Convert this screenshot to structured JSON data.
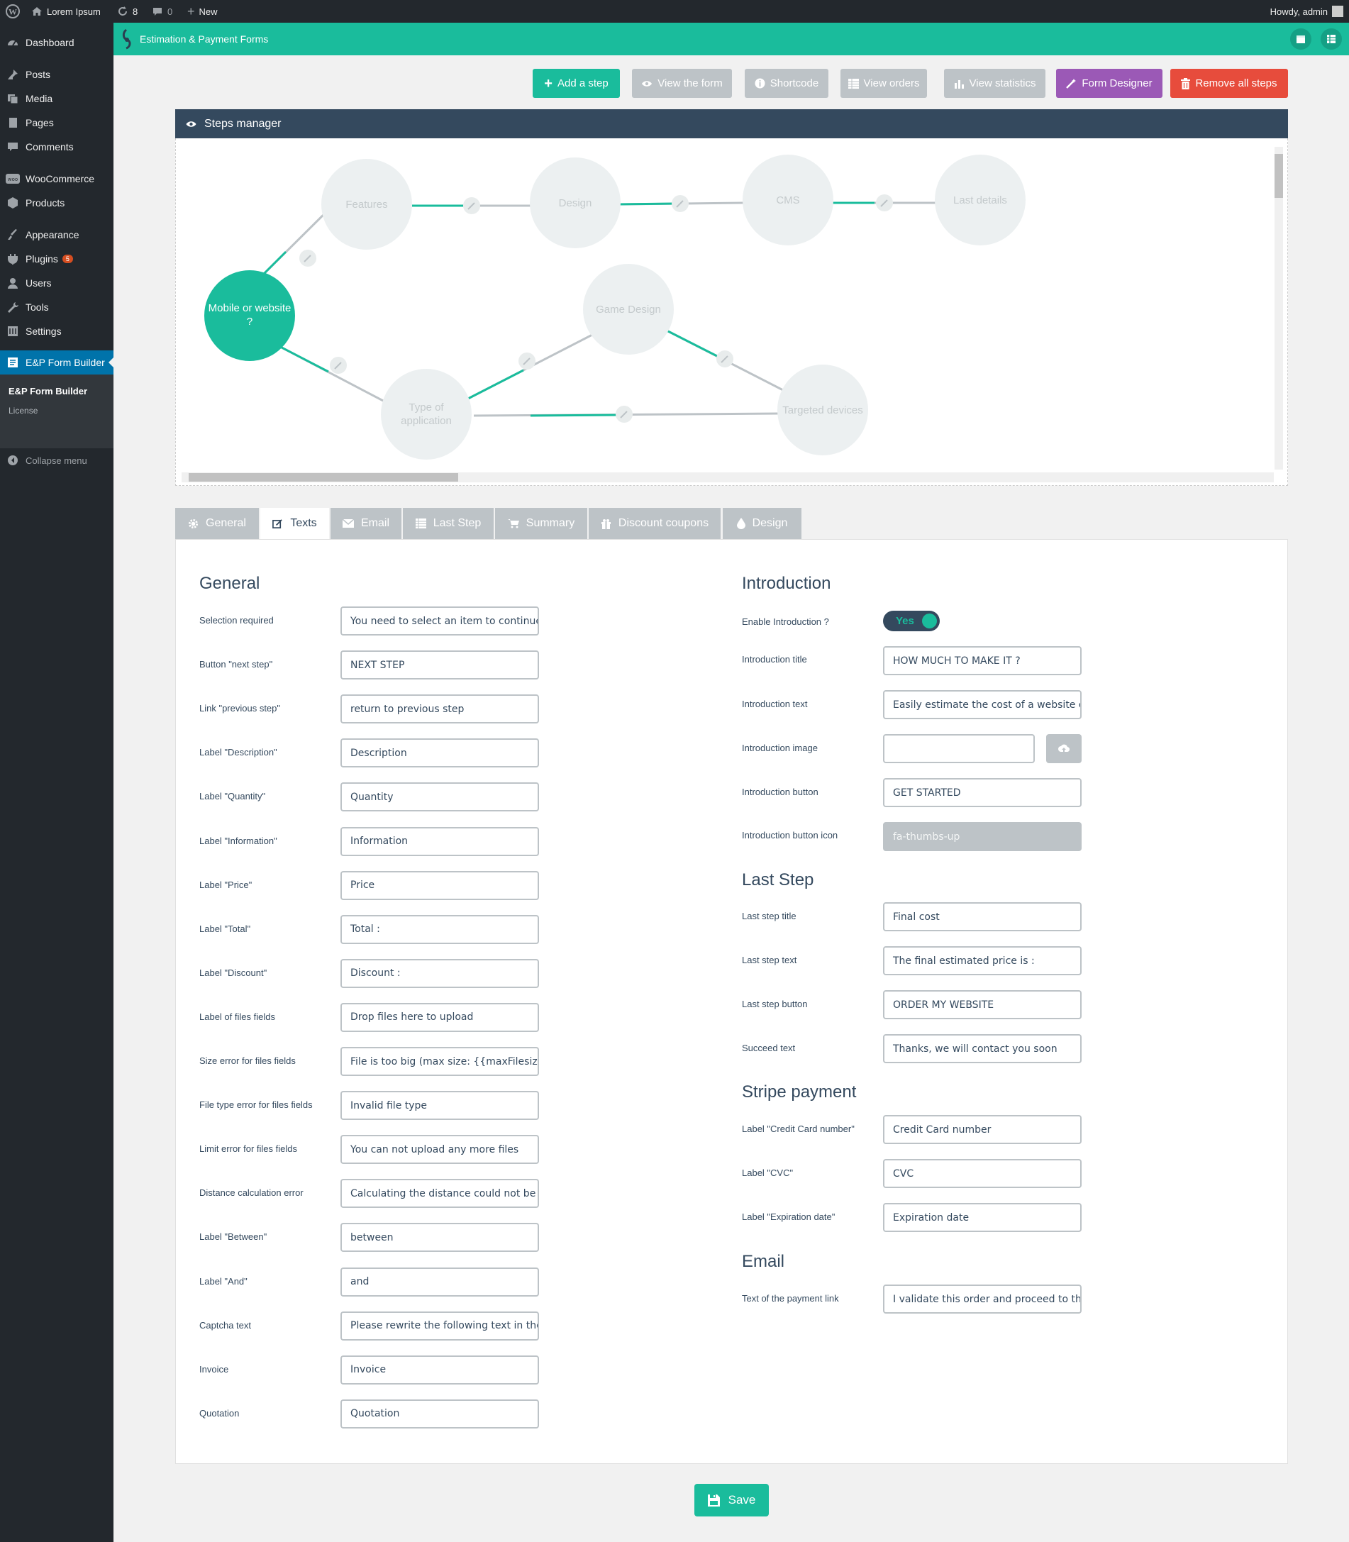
{
  "adminbar": {
    "site_name": "Lorem Ipsum",
    "updates_count": "8",
    "comments_count": "0",
    "new_label": "New",
    "howdy": "Howdy, admin"
  },
  "sidebar": {
    "items": [
      {
        "label": "Dashboard",
        "icon": "dashboard-icon"
      },
      {
        "label": "Posts",
        "icon": "pin-icon"
      },
      {
        "label": "Media",
        "icon": "media-icon"
      },
      {
        "label": "Pages",
        "icon": "page-icon"
      },
      {
        "label": "Comments",
        "icon": "comment-icon"
      },
      {
        "label": "WooCommerce",
        "icon": "woo-icon"
      },
      {
        "label": "Products",
        "icon": "box-icon"
      },
      {
        "label": "Appearance",
        "icon": "brush-icon"
      },
      {
        "label": "Plugins",
        "icon": "plug-icon",
        "badge": "5"
      },
      {
        "label": "Users",
        "icon": "user-icon"
      },
      {
        "label": "Tools",
        "icon": "wrench-icon"
      },
      {
        "label": "Settings",
        "icon": "settings-icon"
      },
      {
        "label": "E&P Form Builder",
        "icon": "form-icon"
      }
    ],
    "submenu": {
      "builder": "E&P Form Builder",
      "license": "License"
    },
    "collapse": "Collapse menu"
  },
  "plugin_header": {
    "title": "Estimation & Payment Forms"
  },
  "toolbar": {
    "add_step": "Add a step",
    "view_form": "View the form",
    "shortcode": "Shortcode",
    "view_orders": "View orders",
    "view_statistics": "View statistics",
    "form_designer": "Form Designer",
    "remove_all_steps": "Remove all steps"
  },
  "steps_manager": {
    "title": "Steps manager",
    "steps": {
      "mobile_line1": "Mobile or website",
      "mobile_line2": "?",
      "features": "Features",
      "design": "Design",
      "cms": "CMS",
      "last_details": "Last details",
      "game_design": "Game Design",
      "type_line1": "Type of",
      "type_line2": "application",
      "targeted_devices": "Targeted devices"
    }
  },
  "tabs": [
    "General",
    "Texts",
    "Email",
    "Last Step",
    "Summary",
    "Discount coupons",
    "Design"
  ],
  "general": {
    "title": "General",
    "fields": [
      {
        "label": "Selection required",
        "value": "You need to select an item to continue"
      },
      {
        "label": "Button \"next step\"",
        "value": "NEXT STEP"
      },
      {
        "label": "Link \"previous step\"",
        "value": "return to previous step"
      },
      {
        "label": "Label \"Description\"",
        "value": "Description"
      },
      {
        "label": "Label \"Quantity\"",
        "value": "Quantity"
      },
      {
        "label": "Label \"Information\"",
        "value": "Information"
      },
      {
        "label": "Label \"Price\"",
        "value": "Price"
      },
      {
        "label": "Label \"Total\"",
        "value": "Total :"
      },
      {
        "label": "Label \"Discount\"",
        "value": "Discount :"
      },
      {
        "label": "Label of files fields",
        "value": "Drop files here to upload"
      },
      {
        "label": "Size error for files fields",
        "value": "File is too big (max size: {{maxFilesize}}MB)"
      },
      {
        "label": "File type error for files fields",
        "value": "Invalid file type"
      },
      {
        "label": "Limit error for files fields",
        "value": "You can not upload any more files"
      },
      {
        "label": "Distance calculation error",
        "value": "Calculating the distance could not be performed"
      },
      {
        "label": "Label \"Between\"",
        "value": "between"
      },
      {
        "label": "Label \"And\"",
        "value": "and"
      },
      {
        "label": "Captcha text",
        "value": "Please rewrite the following text in the field"
      },
      {
        "label": "Invoice",
        "value": "Invoice"
      },
      {
        "label": "Quotation",
        "value": "Quotation"
      }
    ]
  },
  "introduction": {
    "title": "Introduction",
    "enable_label": "Enable Introduction ?",
    "enable_value": "Yes",
    "title_label": "Introduction title",
    "title_value": "HOW MUCH TO MAKE IT ?",
    "text_label": "Introduction text",
    "text_value": "Easily estimate the cost of a website or an app",
    "image_label": "Introduction image",
    "image_value": "",
    "button_label": "Introduction button",
    "button_value": "GET STARTED",
    "icon_label": "Introduction button icon",
    "icon_value": "fa-thumbs-up"
  },
  "last_step": {
    "title": "Last Step",
    "fields": [
      {
        "label": "Last step title",
        "value": "Final cost"
      },
      {
        "label": "Last step text",
        "value": "The final estimated price is :"
      },
      {
        "label": "Last step button",
        "value": "ORDER MY WEBSITE"
      },
      {
        "label": "Succeed text",
        "value": "Thanks, we will contact you soon"
      }
    ]
  },
  "stripe": {
    "title": "Stripe payment",
    "fields": [
      {
        "label": "Label \"Credit Card number\"",
        "value": "Credit Card number"
      },
      {
        "label": "Label \"CVC\"",
        "value": "CVC"
      },
      {
        "label": "Label \"Expiration date\"",
        "value": "Expiration date"
      }
    ]
  },
  "email": {
    "title": "Email",
    "fields": [
      {
        "label": "Text of the payment link",
        "value": "I validate this order and proceed to the payment"
      }
    ]
  },
  "save_label": "Save",
  "colors": {
    "teal": "#1abc9c",
    "dark": "#34495e",
    "gray": "#bdc3c7",
    "purple": "#9b59b6",
    "red": "#e74c3c",
    "wp_dark": "#23282d",
    "wp_blue": "#0073aa"
  }
}
